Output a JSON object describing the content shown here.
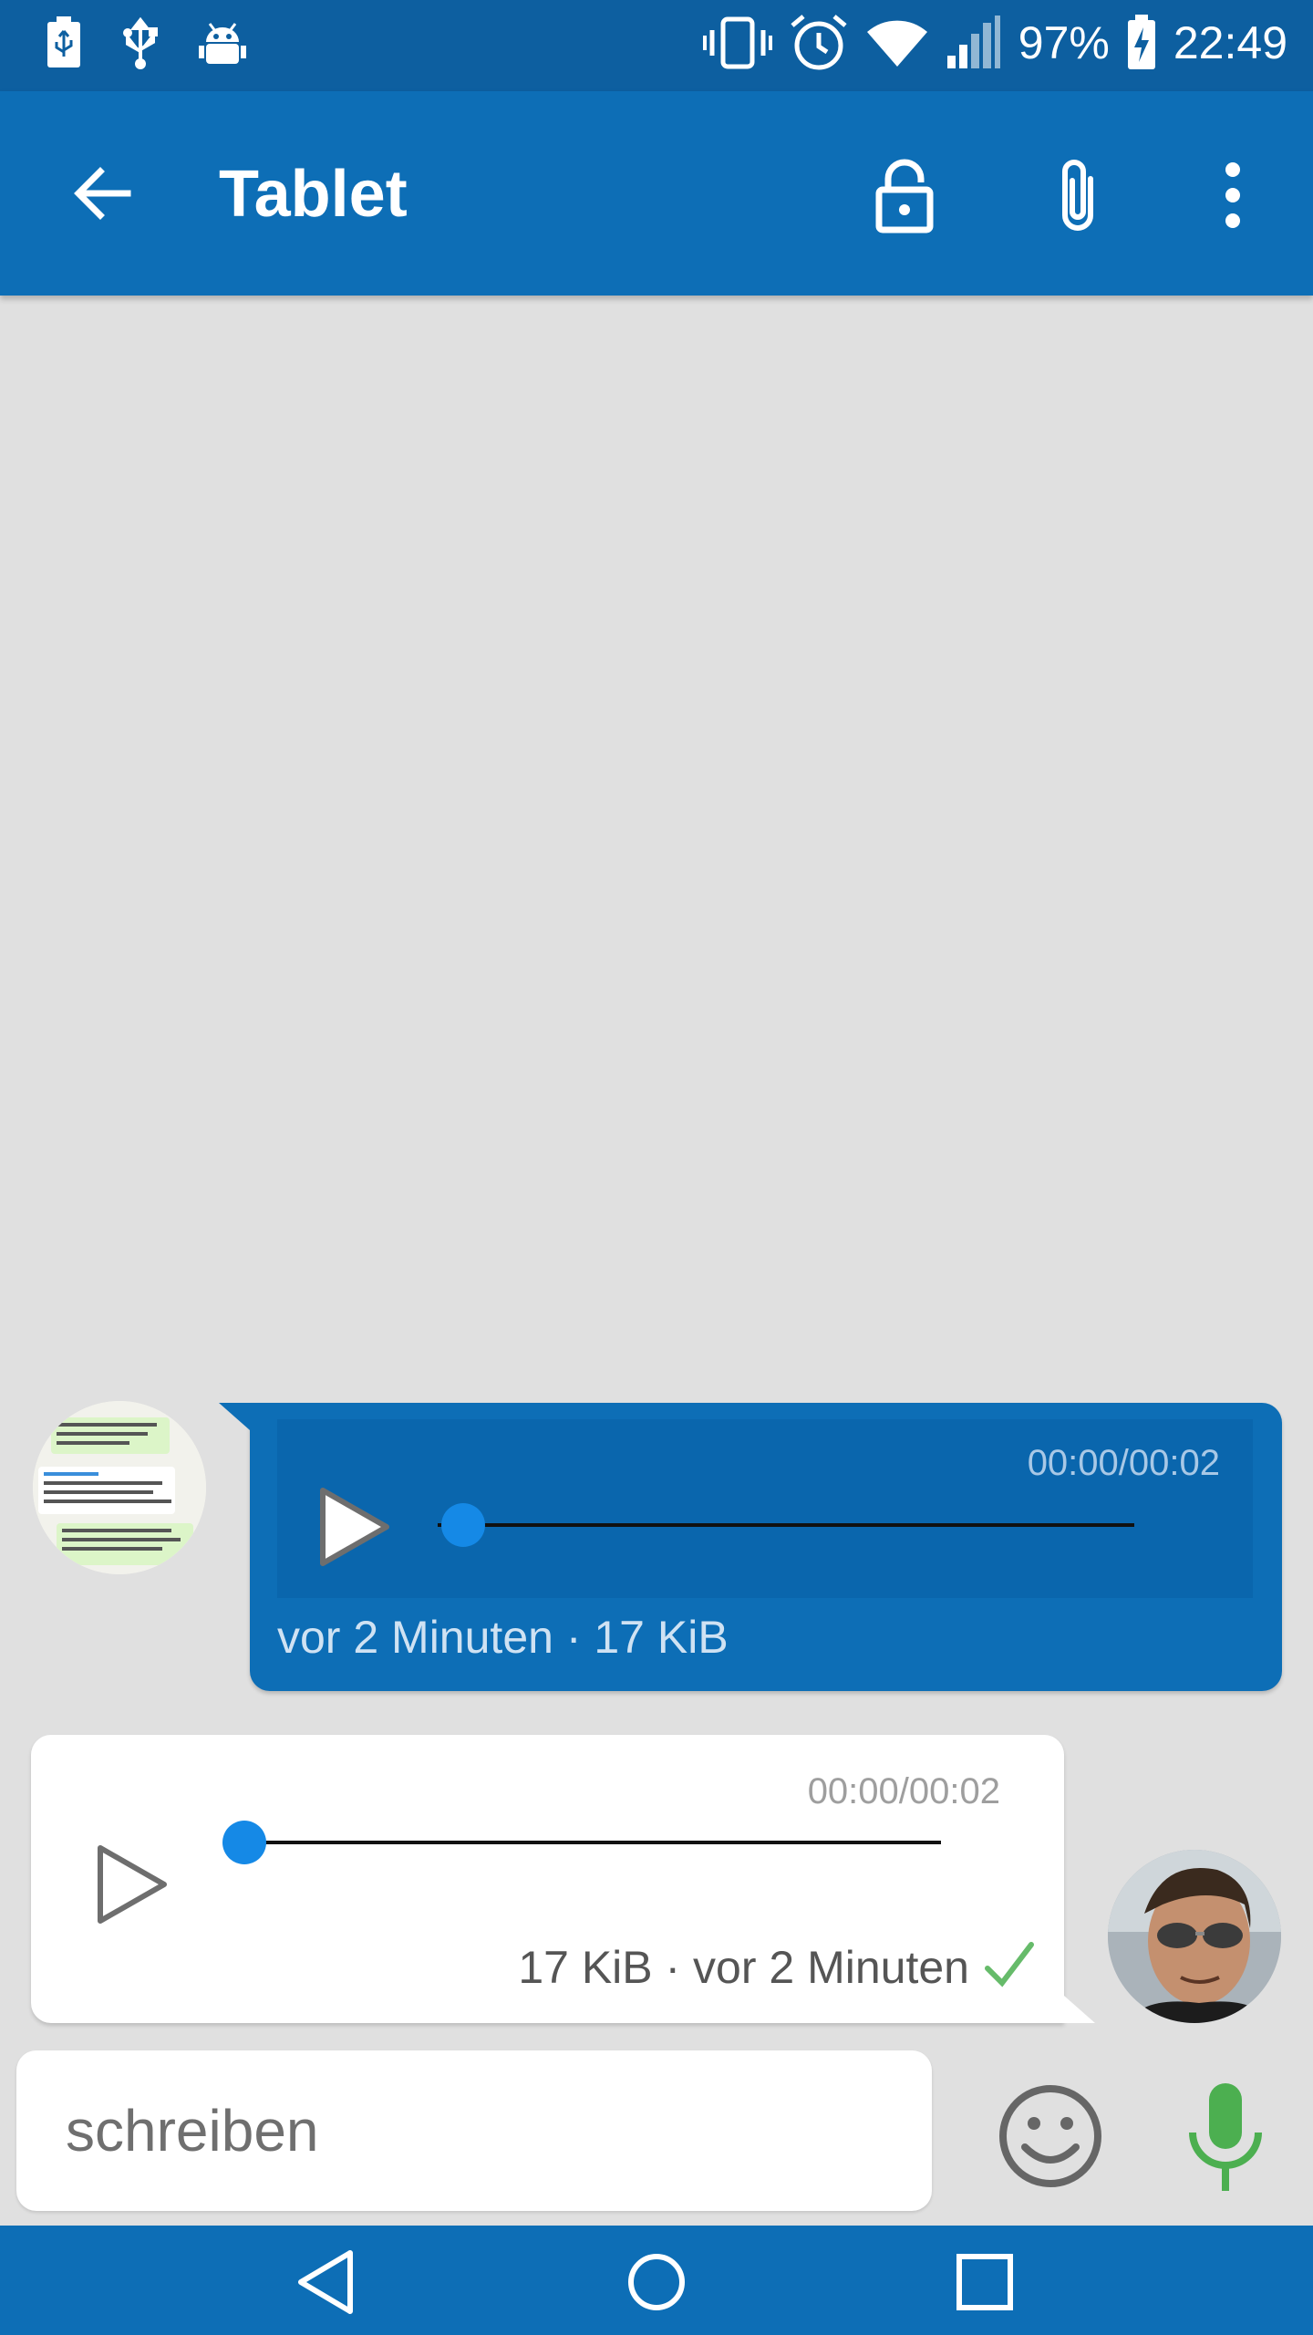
{
  "status_bar": {
    "battery_percent": "97%",
    "time": "22:49",
    "left_icons": [
      "usb-debug-icon",
      "usb-icon",
      "android-debug-icon"
    ],
    "right_icons": [
      "vibrate-icon",
      "alarm-icon",
      "wifi-icon",
      "signal-icon",
      "battery-charging-icon"
    ]
  },
  "toolbar": {
    "title": "Tablet",
    "icons": [
      "back-arrow-icon",
      "lock-icon",
      "paperclip-icon",
      "more-vert-icon"
    ]
  },
  "messages": [
    {
      "direction": "incoming",
      "time_display": "00:00/00:02",
      "meta": "vor 2 Minuten · 17 KiB",
      "progress": 0
    },
    {
      "direction": "outgoing",
      "time_display": "00:00/00:02",
      "meta": "17 KiB · vor 2 Minuten",
      "status_icon": "check-icon",
      "progress": 0
    }
  ],
  "composer": {
    "placeholder": "schreiben",
    "value": ""
  },
  "colors": {
    "status_bar": "#0d5fa0",
    "toolbar": "#0d6eb6",
    "background": "#e0e0e0",
    "progress_dot": "#1589e6",
    "mic": "#4caf50",
    "check": "#66bb6a"
  }
}
